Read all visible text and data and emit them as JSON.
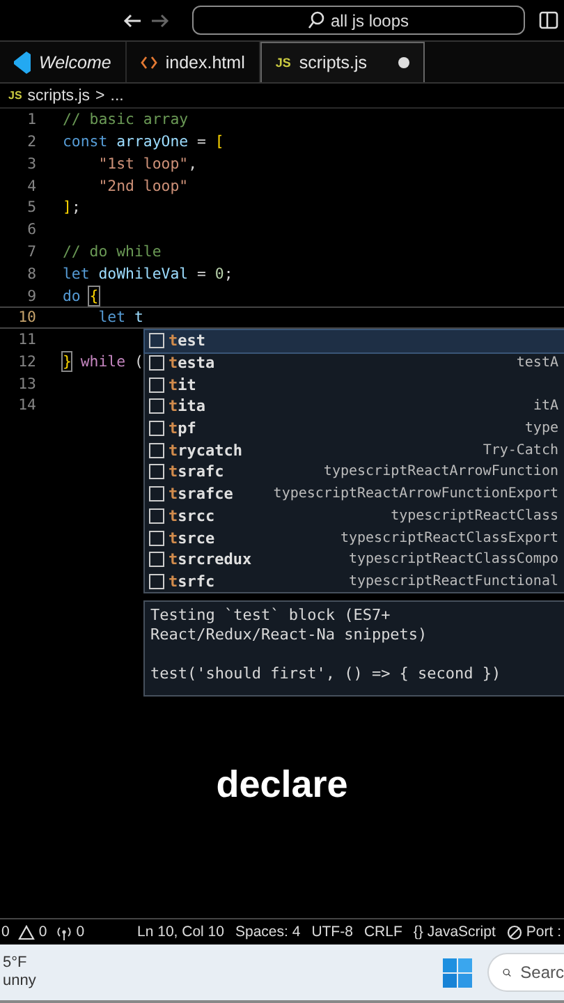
{
  "titlebar": {
    "search": "all js loops"
  },
  "tabs": [
    {
      "label": "Welcome",
      "kind": "vscode",
      "selected": false,
      "preview": true,
      "modified": false
    },
    {
      "label": "index.html",
      "kind": "html",
      "selected": false,
      "preview": false,
      "modified": false
    },
    {
      "label": "scripts.js",
      "kind": "js",
      "icon_text": "JS",
      "selected": true,
      "preview": false,
      "modified": true
    }
  ],
  "breadcrumb": {
    "icon_text": "JS",
    "file": "scripts.js",
    "separator": ">",
    "rest": "..."
  },
  "editor": {
    "lines": [
      {
        "number": "1",
        "current": false,
        "tokens": [
          {
            "text": "// basic array",
            "kind": "comment"
          }
        ]
      },
      {
        "number": "2",
        "current": false,
        "tokens": [
          {
            "text": "const",
            "kind": "keyword"
          },
          {
            "text": " arrayOne",
            "kind": "variable"
          },
          {
            "text": " = ",
            "kind": "plain"
          },
          {
            "text": "[",
            "kind": "bracket"
          }
        ]
      },
      {
        "number": "3",
        "current": false,
        "tokens": [
          {
            "text": "    \"1st loop\"",
            "kind": "string"
          },
          {
            "text": ",",
            "kind": "plain"
          }
        ]
      },
      {
        "number": "4",
        "current": false,
        "tokens": [
          {
            "text": "    \"2nd loop\"",
            "kind": "string"
          }
        ]
      },
      {
        "number": "5",
        "current": false,
        "tokens": [
          {
            "text": "]",
            "kind": "bracket"
          },
          {
            "text": ";",
            "kind": "plain"
          }
        ]
      },
      {
        "number": "6",
        "current": false
      },
      {
        "number": "7",
        "current": false,
        "tokens": [
          {
            "text": "// do while",
            "kind": "comment"
          }
        ]
      },
      {
        "number": "8",
        "current": false,
        "tokens": [
          {
            "text": "let",
            "kind": "keyword"
          },
          {
            "text": " doWhileVal",
            "kind": "variable"
          },
          {
            "text": " = ",
            "kind": "plain"
          },
          {
            "text": "0",
            "kind": "number"
          },
          {
            "text": ";",
            "kind": "plain"
          }
        ]
      },
      {
        "number": "9",
        "current": false,
        "tokens": [
          {
            "text": "do",
            "kind": "keyword"
          },
          {
            "text": "{",
            "kind": "bracket-match"
          }
        ]
      },
      {
        "number": "10",
        "current": true,
        "tokens": [
          {
            "text": "    let",
            "kind": "keyword"
          },
          {
            "text": " t",
            "kind": "variable"
          }
        ]
      },
      {
        "number": "11",
        "current": false
      },
      {
        "number": "12",
        "current": false,
        "tokens": [
          {
            "text": "}",
            "kind": "bracket-match"
          },
          {
            "text": " while",
            "kind": "control"
          },
          {
            "text": " (",
            "kind": "plain"
          }
        ]
      },
      {
        "number": "13",
        "current": false
      },
      {
        "number": "14",
        "current": false
      }
    ]
  },
  "suggest": {
    "items": [
      {
        "label": "test",
        "selected": true
      },
      {
        "label": "testa",
        "detail": "testA",
        "selected": false
      },
      {
        "label": "tit",
        "selected": false
      },
      {
        "label": "tita",
        "detail": "itA",
        "selected": false
      },
      {
        "label": "tpf",
        "detail": "type",
        "selected": false
      },
      {
        "label": "trycatch",
        "detail": "Try-Catch",
        "selected": false
      },
      {
        "label": "tsrafc",
        "detail": "typescriptReactArrowFunction",
        "selected": false
      },
      {
        "label": "tsrafce",
        "detail": "typescriptReactArrowFunctionExport",
        "selected": false
      },
      {
        "label": "tsrcc",
        "detail": "typescriptReactClass",
        "selected": false
      },
      {
        "label": "tsrce",
        "detail": "typescriptReactClassExport",
        "selected": false
      },
      {
        "label": "tsrcredux",
        "detail": "typescriptReactClassCompo",
        "selected": false
      },
      {
        "label": "tsrfc",
        "detail": "typescriptReactFunctional",
        "selected": false
      }
    ],
    "doc": "Testing `test` block (ES7+ React/Redux/React-Na snippets)",
    "example": "test('should first', () => { second })"
  },
  "caption": "declare",
  "status": {
    "left": [
      {
        "kind": "plain",
        "text": "0"
      },
      {
        "kind": "warning",
        "text": "0"
      },
      {
        "kind": "broadcast",
        "text": "0"
      }
    ],
    "right": [
      {
        "kind": "plain",
        "text": "Ln 10, Col 10"
      },
      {
        "kind": "plain",
        "text": "Spaces: 4"
      },
      {
        "kind": "plain",
        "text": "UTF-8"
      },
      {
        "kind": "plain",
        "text": "CRLF"
      },
      {
        "kind": "braces",
        "glyph": "{}",
        "text": "JavaScript"
      },
      {
        "kind": "port",
        "text": "Port :"
      }
    ]
  },
  "taskbar": {
    "temperature": "5°F",
    "weather": "unny",
    "search": "Searc"
  }
}
